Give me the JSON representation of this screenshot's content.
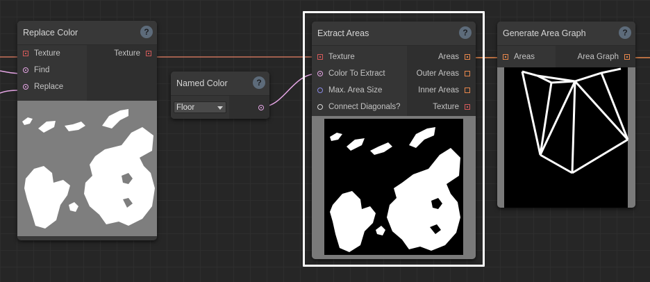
{
  "colors": {
    "texture_wire": "#c8725a",
    "color_wire": "#e6a6e6",
    "areas_wire": "#e8874c",
    "selection": "#ffffff"
  },
  "nodes": {
    "replace_color": {
      "title": "Replace Color",
      "help": "?",
      "inputs": [
        "Texture",
        "Find",
        "Replace"
      ],
      "outputs": [
        "Texture"
      ]
    },
    "named_color": {
      "title": "Named Color",
      "help": "?",
      "selected": "Floor"
    },
    "extract_areas": {
      "title": "Extract Areas",
      "help": "?",
      "inputs": [
        "Texture",
        "Color To Extract",
        "Max. Area Size",
        "Connect Diagonals?"
      ],
      "outputs": [
        "Areas",
        "Outer Areas",
        "Inner Areas",
        "Texture"
      ]
    },
    "generate_area_graph": {
      "title": "Generate Area Graph",
      "help": "?",
      "inputs": [
        "Areas"
      ],
      "outputs": [
        "Area Graph"
      ]
    }
  }
}
